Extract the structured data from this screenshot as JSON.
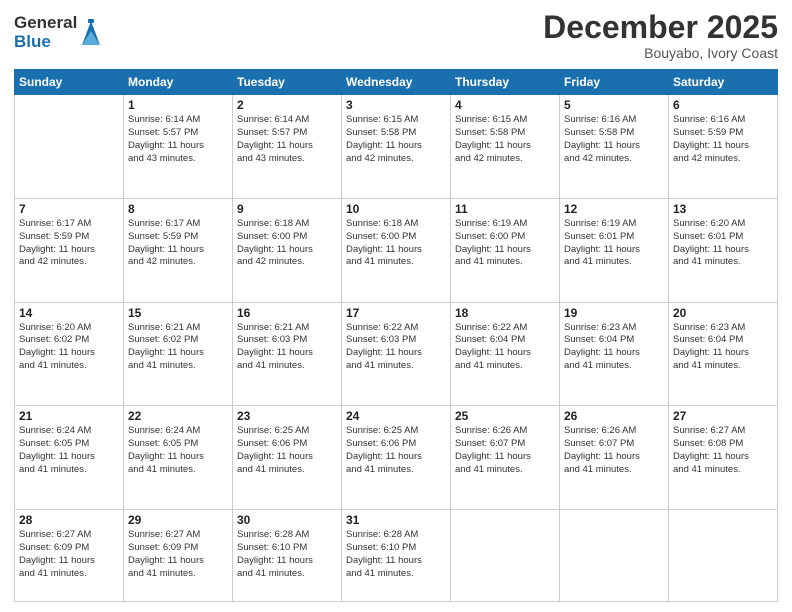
{
  "logo": {
    "general": "General",
    "blue": "Blue"
  },
  "title": "December 2025",
  "location": "Bouyabo, Ivory Coast",
  "headers": [
    "Sunday",
    "Monday",
    "Tuesday",
    "Wednesday",
    "Thursday",
    "Friday",
    "Saturday"
  ],
  "weeks": [
    [
      {
        "day": "",
        "info": ""
      },
      {
        "day": "1",
        "info": "Sunrise: 6:14 AM\nSunset: 5:57 PM\nDaylight: 11 hours\nand 43 minutes."
      },
      {
        "day": "2",
        "info": "Sunrise: 6:14 AM\nSunset: 5:57 PM\nDaylight: 11 hours\nand 43 minutes."
      },
      {
        "day": "3",
        "info": "Sunrise: 6:15 AM\nSunset: 5:58 PM\nDaylight: 11 hours\nand 42 minutes."
      },
      {
        "day": "4",
        "info": "Sunrise: 6:15 AM\nSunset: 5:58 PM\nDaylight: 11 hours\nand 42 minutes."
      },
      {
        "day": "5",
        "info": "Sunrise: 6:16 AM\nSunset: 5:58 PM\nDaylight: 11 hours\nand 42 minutes."
      },
      {
        "day": "6",
        "info": "Sunrise: 6:16 AM\nSunset: 5:59 PM\nDaylight: 11 hours\nand 42 minutes."
      }
    ],
    [
      {
        "day": "7",
        "info": "Sunrise: 6:17 AM\nSunset: 5:59 PM\nDaylight: 11 hours\nand 42 minutes."
      },
      {
        "day": "8",
        "info": "Sunrise: 6:17 AM\nSunset: 5:59 PM\nDaylight: 11 hours\nand 42 minutes."
      },
      {
        "day": "9",
        "info": "Sunrise: 6:18 AM\nSunset: 6:00 PM\nDaylight: 11 hours\nand 42 minutes."
      },
      {
        "day": "10",
        "info": "Sunrise: 6:18 AM\nSunset: 6:00 PM\nDaylight: 11 hours\nand 41 minutes."
      },
      {
        "day": "11",
        "info": "Sunrise: 6:19 AM\nSunset: 6:00 PM\nDaylight: 11 hours\nand 41 minutes."
      },
      {
        "day": "12",
        "info": "Sunrise: 6:19 AM\nSunset: 6:01 PM\nDaylight: 11 hours\nand 41 minutes."
      },
      {
        "day": "13",
        "info": "Sunrise: 6:20 AM\nSunset: 6:01 PM\nDaylight: 11 hours\nand 41 minutes."
      }
    ],
    [
      {
        "day": "14",
        "info": "Sunrise: 6:20 AM\nSunset: 6:02 PM\nDaylight: 11 hours\nand 41 minutes."
      },
      {
        "day": "15",
        "info": "Sunrise: 6:21 AM\nSunset: 6:02 PM\nDaylight: 11 hours\nand 41 minutes."
      },
      {
        "day": "16",
        "info": "Sunrise: 6:21 AM\nSunset: 6:03 PM\nDaylight: 11 hours\nand 41 minutes."
      },
      {
        "day": "17",
        "info": "Sunrise: 6:22 AM\nSunset: 6:03 PM\nDaylight: 11 hours\nand 41 minutes."
      },
      {
        "day": "18",
        "info": "Sunrise: 6:22 AM\nSunset: 6:04 PM\nDaylight: 11 hours\nand 41 minutes."
      },
      {
        "day": "19",
        "info": "Sunrise: 6:23 AM\nSunset: 6:04 PM\nDaylight: 11 hours\nand 41 minutes."
      },
      {
        "day": "20",
        "info": "Sunrise: 6:23 AM\nSunset: 6:04 PM\nDaylight: 11 hours\nand 41 minutes."
      }
    ],
    [
      {
        "day": "21",
        "info": "Sunrise: 6:24 AM\nSunset: 6:05 PM\nDaylight: 11 hours\nand 41 minutes."
      },
      {
        "day": "22",
        "info": "Sunrise: 6:24 AM\nSunset: 6:05 PM\nDaylight: 11 hours\nand 41 minutes."
      },
      {
        "day": "23",
        "info": "Sunrise: 6:25 AM\nSunset: 6:06 PM\nDaylight: 11 hours\nand 41 minutes."
      },
      {
        "day": "24",
        "info": "Sunrise: 6:25 AM\nSunset: 6:06 PM\nDaylight: 11 hours\nand 41 minutes."
      },
      {
        "day": "25",
        "info": "Sunrise: 6:26 AM\nSunset: 6:07 PM\nDaylight: 11 hours\nand 41 minutes."
      },
      {
        "day": "26",
        "info": "Sunrise: 6:26 AM\nSunset: 6:07 PM\nDaylight: 11 hours\nand 41 minutes."
      },
      {
        "day": "27",
        "info": "Sunrise: 6:27 AM\nSunset: 6:08 PM\nDaylight: 11 hours\nand 41 minutes."
      }
    ],
    [
      {
        "day": "28",
        "info": "Sunrise: 6:27 AM\nSunset: 6:09 PM\nDaylight: 11 hours\nand 41 minutes."
      },
      {
        "day": "29",
        "info": "Sunrise: 6:27 AM\nSunset: 6:09 PM\nDaylight: 11 hours\nand 41 minutes."
      },
      {
        "day": "30",
        "info": "Sunrise: 6:28 AM\nSunset: 6:10 PM\nDaylight: 11 hours\nand 41 minutes."
      },
      {
        "day": "31",
        "info": "Sunrise: 6:28 AM\nSunset: 6:10 PM\nDaylight: 11 hours\nand 41 minutes."
      },
      {
        "day": "",
        "info": ""
      },
      {
        "day": "",
        "info": ""
      },
      {
        "day": "",
        "info": ""
      }
    ]
  ]
}
